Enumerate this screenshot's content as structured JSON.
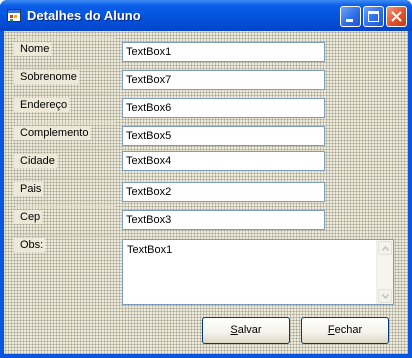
{
  "window": {
    "title": "Detalhes do Aluno",
    "icons": {
      "app": "app-form-icon",
      "minimize": "minimize-icon",
      "maximize": "maximize-icon",
      "close": "close-icon"
    }
  },
  "form": {
    "fields": [
      {
        "label": "Nome",
        "value": "TextBox1"
      },
      {
        "label": "Sobrenome",
        "value": "TextBox7"
      },
      {
        "label": "Endereço",
        "value": "TextBox6"
      },
      {
        "label": "Complemento",
        "value": "TextBox5"
      },
      {
        "label": "Cidade",
        "value": "TextBox4"
      },
      {
        "label": "Pais",
        "value": "TextBox2"
      },
      {
        "label": "Cep",
        "value": "TextBox3"
      }
    ],
    "obs": {
      "label": "Obs:",
      "value": "TextBox1"
    }
  },
  "buttons": {
    "save": {
      "accel": "S",
      "rest": "alvar"
    },
    "close": {
      "accel": "F",
      "rest": "echar"
    }
  }
}
